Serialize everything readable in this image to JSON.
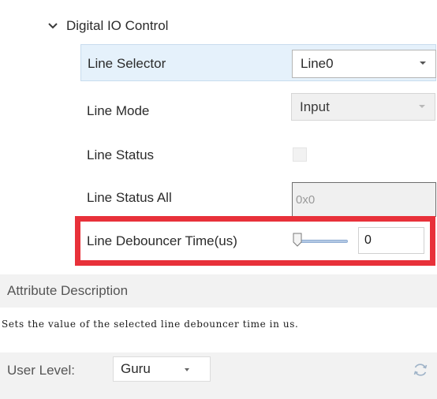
{
  "group": {
    "label": "Digital IO Control",
    "expanded": true
  },
  "rows": {
    "line_selector": {
      "label": "Line Selector",
      "value": "Line0"
    },
    "line_mode": {
      "label": "Line Mode",
      "value": "Input"
    },
    "line_status": {
      "label": "Line Status",
      "checked": false
    },
    "line_status_all": {
      "label": "Line Status All",
      "value": "0x0"
    },
    "line_debouncer": {
      "label": "Line Debouncer Time(us)",
      "value": "0",
      "slider_fraction": 0
    }
  },
  "description": {
    "header": "Attribute Description",
    "text": "Sets the value of the selected line debouncer time in us."
  },
  "footer": {
    "user_level_label": "User Level:",
    "user_level_value": "Guru"
  },
  "colors": {
    "highlight": "#e8313a",
    "selected_row": "#e5f1fb",
    "panel_gray": "#f2f2f2"
  },
  "icons": {
    "expand": "chevron-down-icon",
    "refresh": "refresh-icon"
  }
}
